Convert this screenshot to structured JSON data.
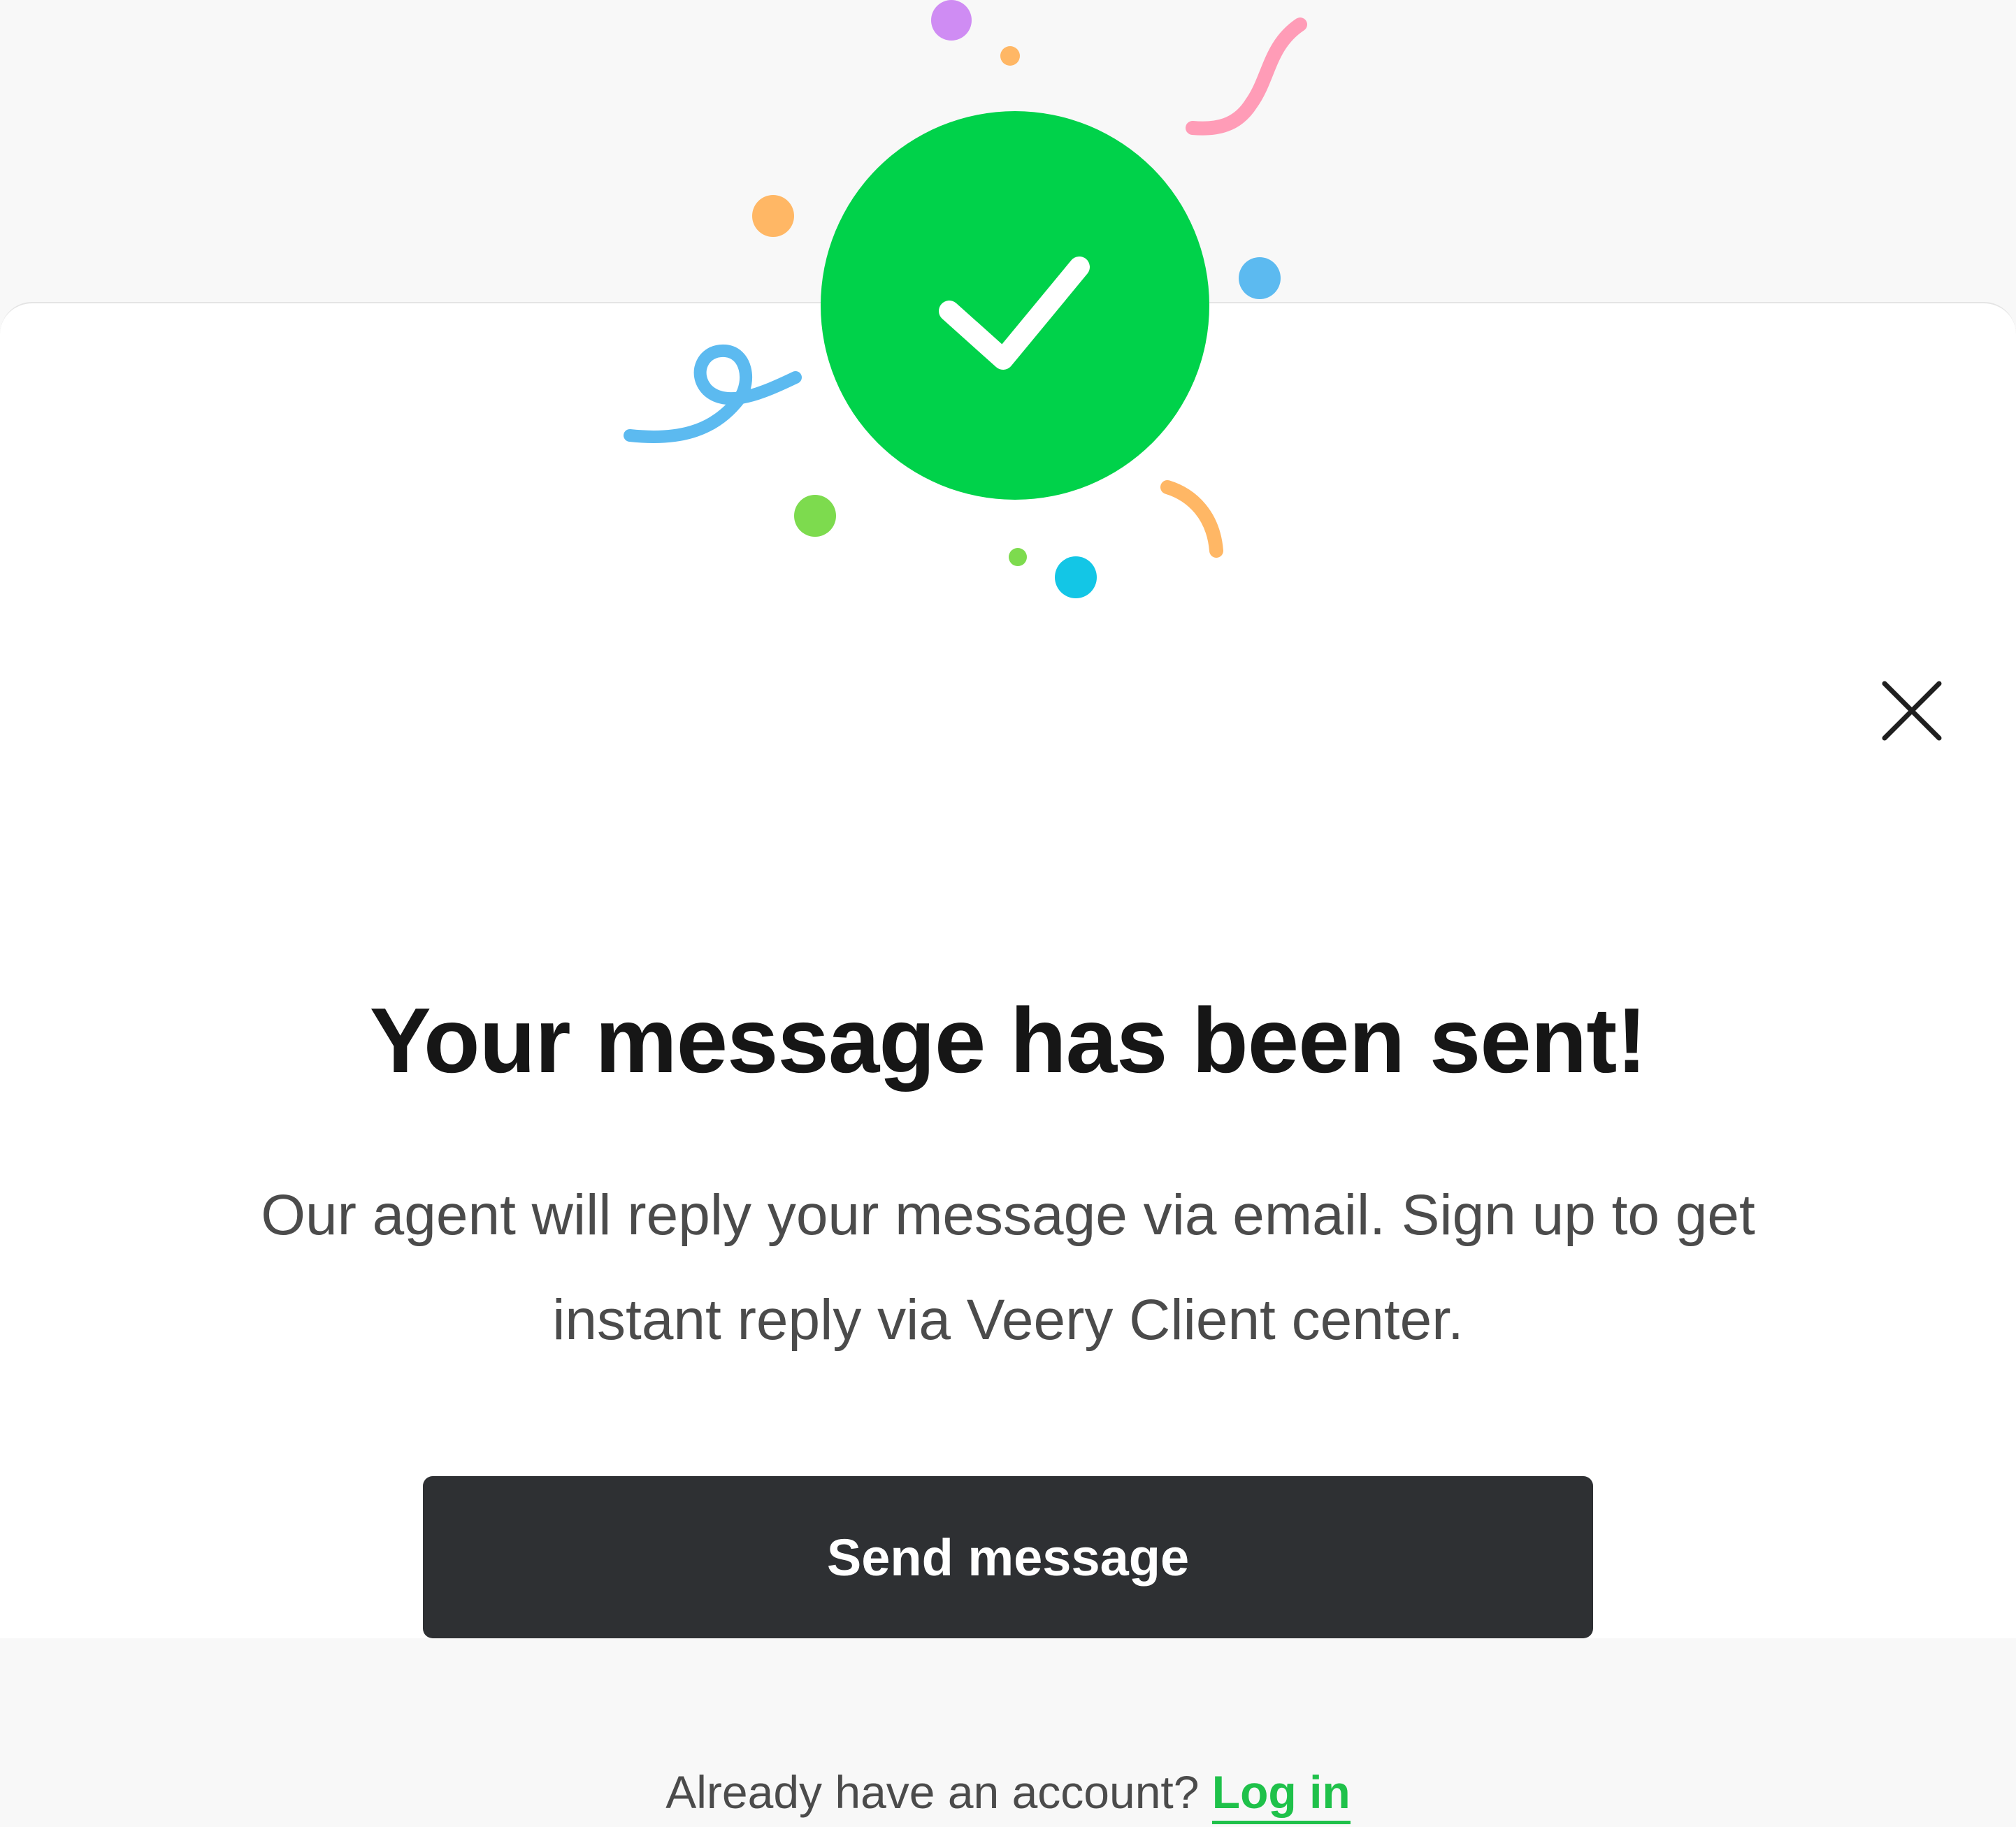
{
  "dialog": {
    "title": "Your message has been sent!",
    "body": "Our agent will reply your message via email. Sign up to get instant reply via Veery Client center.",
    "primary_button_label": "Send message",
    "footer_prompt": "Already have an account?",
    "login_link_label": "Log in"
  },
  "icons": {
    "success": "checkmark-circle-icon",
    "close": "close-icon",
    "decoration": "confetti"
  },
  "colors": {
    "success_green": "#00d24a",
    "button_dark": "#2e3033",
    "link_green": "#1fc14a",
    "title_text": "#161616",
    "body_text": "#4b4b4b"
  }
}
